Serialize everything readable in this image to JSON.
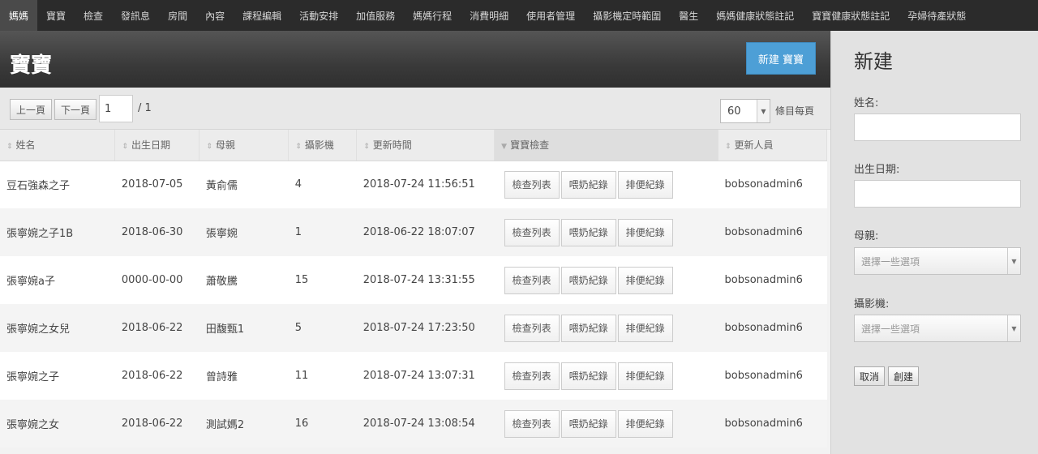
{
  "nav": {
    "items": [
      "媽媽",
      "寶寶",
      "檢查",
      "發訊息",
      "房間",
      "內容",
      "課程編輯",
      "活動安排",
      "加值服務",
      "媽媽行程",
      "消費明細",
      "使用者管理",
      "攝影機定時範圍",
      "醫生",
      "媽媽健康狀態註記",
      "寶寶健康狀態註記",
      "孕婦待產狀態"
    ],
    "active_index": 0
  },
  "header": {
    "title": "寶寶",
    "new_button": "新建 寶寶"
  },
  "pagination": {
    "prev": "上一頁",
    "next": "下一頁",
    "page_value": "1",
    "total": "/ 1",
    "per_page_value": "60",
    "per_page_label": "條目每頁"
  },
  "table": {
    "columns": [
      "姓名",
      "出生日期",
      "母親",
      "攝影機",
      "更新時間",
      "寶寶檢查",
      "更新人員"
    ],
    "sorted_column_index": 5,
    "action_labels": [
      "檢查列表",
      "喂奶紀錄",
      "排便紀錄"
    ],
    "rows": [
      {
        "name": "豆石強森之子",
        "birth": "2018-07-05",
        "mother": "黃俞儒",
        "camera": "4",
        "updated": "2018-07-24 11:56:51",
        "updater": "bobsonadmin6"
      },
      {
        "name": "張寧婉之子1B",
        "birth": "2018-06-30",
        "mother": "張寧婉",
        "camera": "1",
        "updated": "2018-06-22 18:07:07",
        "updater": "bobsonadmin6"
      },
      {
        "name": "張寧婉a子",
        "birth": "0000-00-00",
        "mother": "蕭敬騰",
        "camera": "15",
        "updated": "2018-07-24 13:31:55",
        "updater": "bobsonadmin6"
      },
      {
        "name": "張寧婉之女兒",
        "birth": "2018-06-22",
        "mother": "田馥甄1",
        "camera": "5",
        "updated": "2018-07-24 17:23:50",
        "updater": "bobsonadmin6"
      },
      {
        "name": "張寧婉之子",
        "birth": "2018-06-22",
        "mother": "曾詩雅",
        "camera": "11",
        "updated": "2018-07-24 13:07:31",
        "updater": "bobsonadmin6"
      },
      {
        "name": "張寧婉之女",
        "birth": "2018-06-22",
        "mother": "測試媽2",
        "camera": "16",
        "updated": "2018-07-24 13:08:54",
        "updater": "bobsonadmin6"
      }
    ]
  },
  "side": {
    "title": "新建",
    "name_label": "姓名:",
    "birth_label": "出生日期:",
    "mother_label": "母親:",
    "mother_placeholder": "選擇一些選項",
    "camera_label": "攝影機:",
    "camera_placeholder": "選擇一些選項",
    "cancel": "取消",
    "create": "創建"
  },
  "colors": {
    "accent": "#4d9fd6",
    "topnav": "#2b2b2b"
  }
}
